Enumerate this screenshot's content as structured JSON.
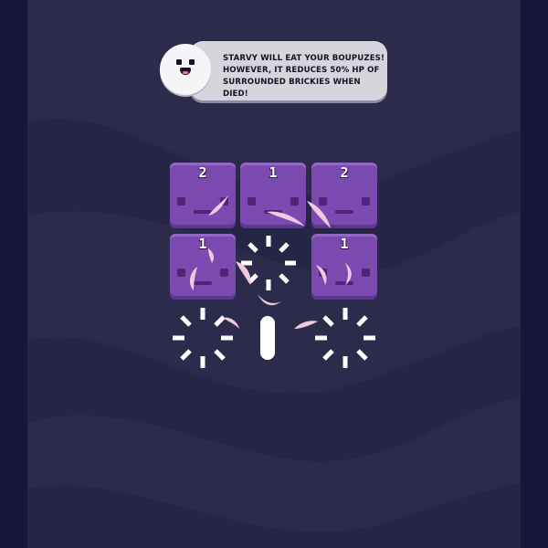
{
  "tutorial": {
    "character": "starvy",
    "message": "STARVY WILL EAT YOUR BOUPUZES!\nHOWEVER, IT REDUCES 50% HP OF\nSURROUNDED BRICKIES WHEN DIED!"
  },
  "board": {
    "bricks": [
      {
        "id": "brick-r1c1",
        "hp": "2"
      },
      {
        "id": "brick-r1c2",
        "hp": "1"
      },
      {
        "id": "brick-r1c3",
        "hp": "2"
      },
      {
        "id": "brick-r2c1",
        "hp": "1"
      },
      {
        "id": "brick-r2c3",
        "hp": "1"
      }
    ]
  },
  "colors": {
    "background": "#2d2b4c",
    "side_panels": "#17163a",
    "brick": "#7a4ab0",
    "bubble": "#d8d4dc",
    "particle": "#f0c8e0",
    "burst": "#ffffff"
  },
  "icons": [
    "starvy-face-icon",
    "burst-icon",
    "shard-icon"
  ]
}
